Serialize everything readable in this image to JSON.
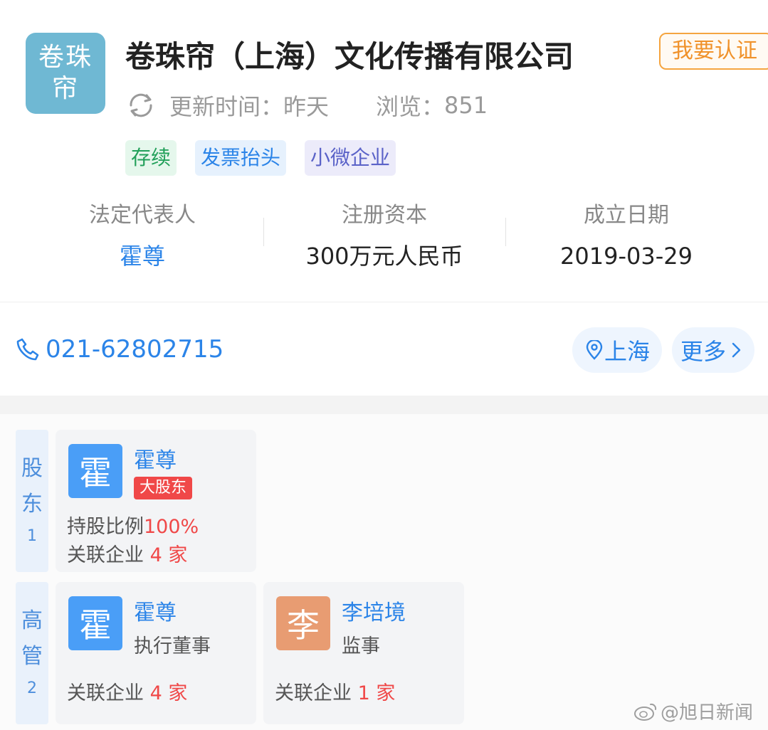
{
  "company": {
    "logo_line1": "卷珠",
    "logo_line2": "帘",
    "name": "卷珠帘（上海）文化传播有限公司",
    "cert_button": "我要认证",
    "update_label": "更新时间：",
    "update_value": "昨天",
    "views_label": "浏览：",
    "views_value": "851",
    "tags": [
      "存续",
      "发票抬头",
      "小微企业"
    ]
  },
  "stats": [
    {
      "label": "法定代表人",
      "value": "霍尊"
    },
    {
      "label": "注册资本",
      "value": "300万元人民币"
    },
    {
      "label": "成立日期",
      "value": "2019-03-29"
    }
  ],
  "contact": {
    "phone": "021-62802715",
    "location": "上海",
    "more": "更多"
  },
  "shareholders": {
    "side_label_1": "股",
    "side_label_2": "东",
    "count": "1",
    "items": [
      {
        "avatar_char": "霍",
        "name": "霍尊",
        "badge": "大股东",
        "ratio_label": "持股比例",
        "ratio_value": "100%",
        "related_label": "关联企业",
        "related_count": "4",
        "related_unit": "家"
      }
    ]
  },
  "executives": {
    "side_label_1": "高",
    "side_label_2": "管",
    "count": "2",
    "items": [
      {
        "avatar_char": "霍",
        "name": "霍尊",
        "role": "执行董事",
        "related_label": "关联企业",
        "related_count": "4",
        "related_unit": "家"
      },
      {
        "avatar_char": "李",
        "name": "李培境",
        "role": "监事",
        "related_label": "关联企业",
        "related_count": "1",
        "related_unit": "家"
      }
    ]
  },
  "watermark": "@旭日新闻",
  "colors": {
    "link_blue": "#2b84e8",
    "accent_orange": "#f0922b",
    "alert_red": "#f04848",
    "logo_teal": "#6fb8d3"
  }
}
